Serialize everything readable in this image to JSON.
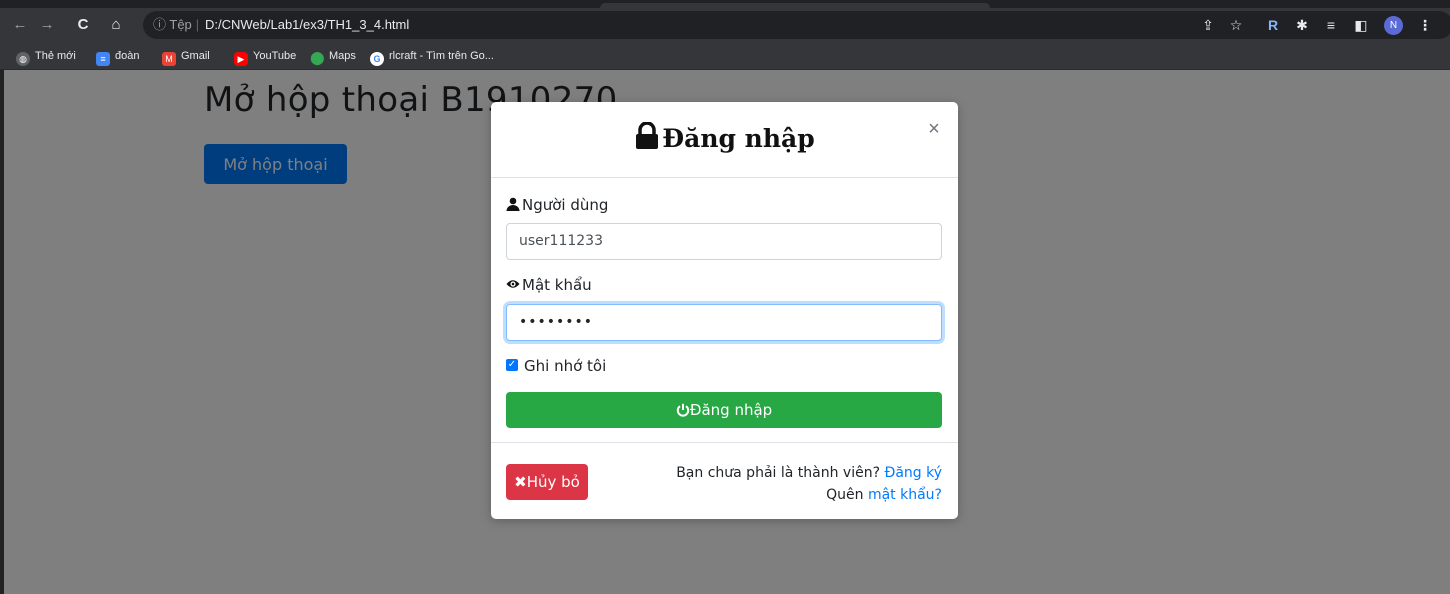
{
  "browser": {
    "url_info": "Tệp",
    "url": "D:/CNWeb/Lab1/ex3/TH1_3_4.html",
    "profile_initial": "N",
    "bookmarks": [
      {
        "label": "Thẻ mới",
        "icon": "globe-icon",
        "color": "#9aa0a6"
      },
      {
        "label": "đoàn",
        "icon": "docs-icon",
        "color": "#4285f4"
      },
      {
        "label": "Gmail",
        "icon": "gmail-icon",
        "color": "#ea4335"
      },
      {
        "label": "YouTube",
        "icon": "youtube-icon",
        "color": "#ff0000"
      },
      {
        "label": "Maps",
        "icon": "maps-icon",
        "color": "#34a853"
      },
      {
        "label": "rlcraft - Tìm trên Go...",
        "icon": "google-icon",
        "color": "#ffffff"
      }
    ]
  },
  "page": {
    "title": "Mở hộp thoại B1910270",
    "open_button": "Mở hộp thoại"
  },
  "modal": {
    "title": "Đăng nhập",
    "close": "×",
    "username_label": "Người dùng",
    "username_value": "user111233",
    "password_label": "Mật khẩu",
    "password_value": "••••••••",
    "remember_label": "Ghi nhớ tôi",
    "remember_checked": true,
    "login_button": "Đăng nhập",
    "cancel_button": "Hủy bỏ",
    "not_member_text": "Bạn chưa phải là thành viên?",
    "register_link": "Đăng ký",
    "forgot_text": "Quên",
    "forgot_link": "mật khẩu?"
  },
  "colors": {
    "primary": "#007bff",
    "success": "#28a745",
    "danger": "#dc3545"
  }
}
